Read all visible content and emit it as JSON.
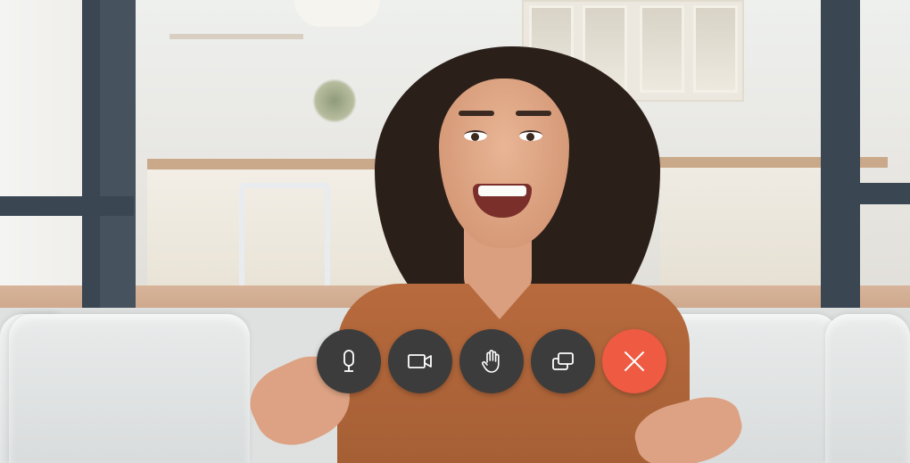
{
  "call": {
    "controls": [
      {
        "id": "microphone",
        "icon": "microphone-icon",
        "label": "Microphone"
      },
      {
        "id": "camera",
        "icon": "video-camera-icon",
        "label": "Camera"
      },
      {
        "id": "raise-hand",
        "icon": "raise-hand-icon",
        "label": "Raise hand"
      },
      {
        "id": "share-screen",
        "icon": "share-screen-icon",
        "label": "Share screen"
      },
      {
        "id": "end-call",
        "icon": "close-icon",
        "label": "End call"
      }
    ],
    "colors": {
      "control_bg": "#3c3c3c",
      "end_call_bg": "#ef5a43",
      "icon_color": "#ffffff"
    }
  }
}
